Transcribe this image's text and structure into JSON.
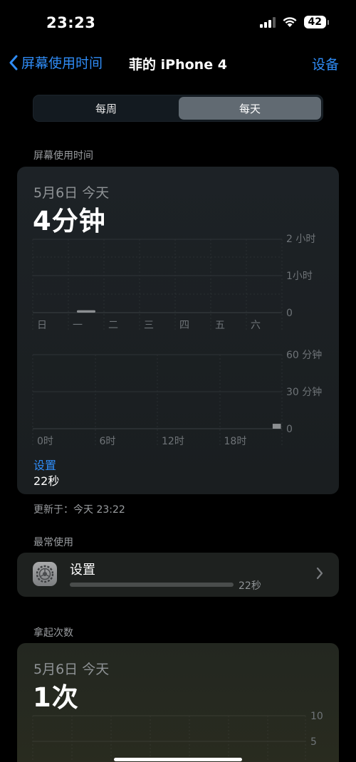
{
  "status_bar": {
    "time": "23:23",
    "battery": "42"
  },
  "nav": {
    "back_label": "屏幕使用时间",
    "title": "菲的 iPhone 4",
    "right_label": "设备"
  },
  "segmented": {
    "options": [
      "每周",
      "每天"
    ],
    "selected": "每天"
  },
  "screen_time": {
    "section_label": "屏幕使用时间",
    "date": "5月6日 今天",
    "total": "4分钟",
    "weekly_chart": {
      "y_labels": [
        "2 小时",
        "1小时",
        "0"
      ],
      "days": [
        "日",
        "一",
        "二",
        "三",
        "四",
        "五",
        "六"
      ]
    },
    "hourly_chart": {
      "y_labels": [
        "60 分钟",
        "30 分钟",
        "0"
      ],
      "hours": [
        "0时",
        "6时",
        "12时",
        "18时"
      ]
    },
    "app_label": "设置",
    "app_time": "22秒",
    "updated": "更新于：今天 23:22"
  },
  "most_used": {
    "section_label": "最常使用",
    "items": [
      {
        "name": "设置",
        "time": "22秒",
        "icon": "settings-gear-icon"
      }
    ]
  },
  "pickups": {
    "section_label": "拿起次数",
    "date": "5月6日 今天",
    "total": "1次",
    "y_labels": [
      "10",
      "5"
    ]
  },
  "chart_data": [
    {
      "type": "bar",
      "categories": [
        "日",
        "一",
        "二",
        "三",
        "四",
        "五",
        "六"
      ],
      "values": [
        0,
        4,
        0,
        0,
        0,
        0,
        0
      ],
      "ylabel": "",
      "ylim": [
        0,
        120
      ],
      "ytick_labels": [
        "0",
        "1小时",
        "2 小时"
      ],
      "grid": true
    },
    {
      "type": "bar",
      "categories": [
        "0时",
        "6时",
        "12时",
        "18时"
      ],
      "x": [
        23
      ],
      "values": [
        4
      ],
      "ylim": [
        0,
        60
      ],
      "ytick_labels": [
        "0",
        "30 分钟",
        "60 分钟"
      ],
      "grid": true
    }
  ],
  "colors": {
    "accent": "#2f8cf6",
    "bar": "#8c8f92",
    "grid": "#2e3337"
  }
}
